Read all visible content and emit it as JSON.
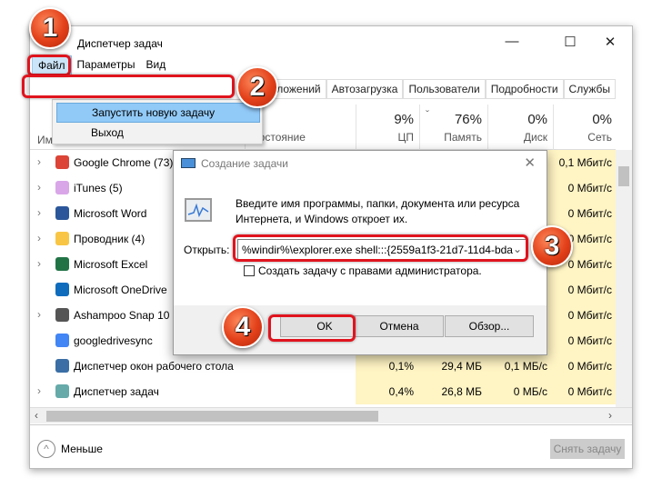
{
  "window": {
    "title": "Диспетчер задач",
    "minimize": "—",
    "maximize": "☐",
    "close": "✕"
  },
  "menu": [
    "Файл",
    "Параметры",
    "Вид"
  ],
  "file_menu": {
    "run_new_task": "Запустить новую задачу",
    "exit": "Выход"
  },
  "tabs": [
    "...ложений",
    "Автозагрузка",
    "Пользователи",
    "Подробности",
    "Службы"
  ],
  "columns": {
    "name": "Имя",
    "status": "Состояние",
    "cpu": {
      "pct": "9%",
      "label": "ЦП"
    },
    "memory": {
      "pct": "76%",
      "label": "Память"
    },
    "disk": {
      "pct": "0%",
      "label": "Диск"
    },
    "network": {
      "pct": "0%",
      "label": "Сеть"
    }
  },
  "rows": [
    {
      "name": "Google Chrome (73)",
      "net": "0,1 Мбит/с",
      "expand": true,
      "icon": "chrome-icon",
      "color": "#db4437"
    },
    {
      "name": "iTunes (5)",
      "net": "0 Мбит/с",
      "expand": true,
      "icon": "itunes-icon",
      "color": "#d9a6e8"
    },
    {
      "name": "Microsoft Word",
      "net": "0 Мбит/с",
      "expand": true,
      "icon": "word-icon",
      "color": "#2b579a"
    },
    {
      "name": "Проводник (4)",
      "net": "0 Мбит/с",
      "expand": true,
      "icon": "folder-icon",
      "color": "#f8c644"
    },
    {
      "name": "Microsoft Excel",
      "net": "0 Мбит/с",
      "expand": true,
      "icon": "excel-icon",
      "color": "#217346"
    },
    {
      "name": "Microsoft OneDrive",
      "net": "0 Мбит/с",
      "expand": false,
      "icon": "onedrive-icon",
      "color": "#0f6cbd"
    },
    {
      "name": "Ashampoo Snap 10",
      "net": "0 Мбит/с",
      "expand": true,
      "icon": "ashampoo-icon",
      "color": "#555"
    },
    {
      "name": "googledrivesync",
      "net": "0 Мбит/с",
      "expand": false,
      "icon": "drive-icon",
      "color": "#4285f4"
    },
    {
      "name": "Диспетчер окон рабочего стола",
      "cpu": "0,1%",
      "mem": "29,4 МБ",
      "disk": "0,1 МБ/с",
      "net": "0 Мбит/с",
      "expand": false,
      "icon": "dwm-icon",
      "color": "#3a6ea5"
    },
    {
      "name": "Диспетчер задач",
      "cpu": "0,4%",
      "mem": "26,8 МБ",
      "disk": "0 МБ/с",
      "net": "0 Мбит/с",
      "expand": true,
      "icon": "taskmgr-icon",
      "color": "#6aa"
    }
  ],
  "footer": {
    "less": "Меньше",
    "end_task": "Снять задачу"
  },
  "dialog": {
    "title": "Создание задачи",
    "close": "✕",
    "description": "Введите имя программы, папки, документа или ресурса Интернета, и Windows откроет их.",
    "open_label": "Открыть:",
    "open_value": "%windir%\\explorer.exe shell:::{2559a1f3-21d7-11d4-bda",
    "admin_checkbox": "Создать задачу с правами администратора.",
    "admin_checked": false,
    "ok": "OK",
    "cancel": "Отмена",
    "browse": "Обзор..."
  },
  "badges": [
    "1",
    "2",
    "3",
    "4"
  ],
  "highlight_color": "#e0141e"
}
